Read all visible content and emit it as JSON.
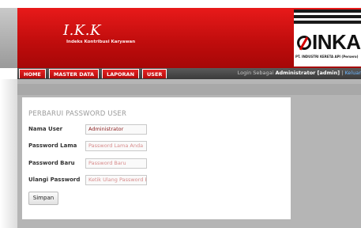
{
  "header": {
    "title": "I.K.K",
    "subtitle": "Indeks Kontribusi Karyawan",
    "logo_text": "INKA",
    "logo_caption": "PT. INDUSTRI KERETA API (Persero)"
  },
  "nav": {
    "items": [
      {
        "label": "HOME"
      },
      {
        "label": "MASTER DATA"
      },
      {
        "label": "LAPORAN"
      },
      {
        "label": "USER"
      }
    ],
    "login_prefix": "Login Sebagai",
    "login_name": "Administrator",
    "login_user": "admin",
    "separator": "|",
    "logout": "Keluar"
  },
  "form": {
    "title": "PERBARUI PASSWORD USER",
    "fields": [
      {
        "label": "Nama User",
        "value": "Administrator",
        "placeholder": ""
      },
      {
        "label": "Password Lama",
        "value": "",
        "placeholder": "Password Lama Anda"
      },
      {
        "label": "Password Baru",
        "value": "",
        "placeholder": "Password Baru"
      },
      {
        "label": "Ulangi Password",
        "value": "",
        "placeholder": "Ketik Ulang Password Baru"
      }
    ],
    "submit_label": "Simpan"
  },
  "colors": {
    "header_red": "#c10d0d",
    "nav_dark": "#3a3a3a",
    "content_gray": "#b5b5b5",
    "link_blue": "#6cb6ff"
  }
}
